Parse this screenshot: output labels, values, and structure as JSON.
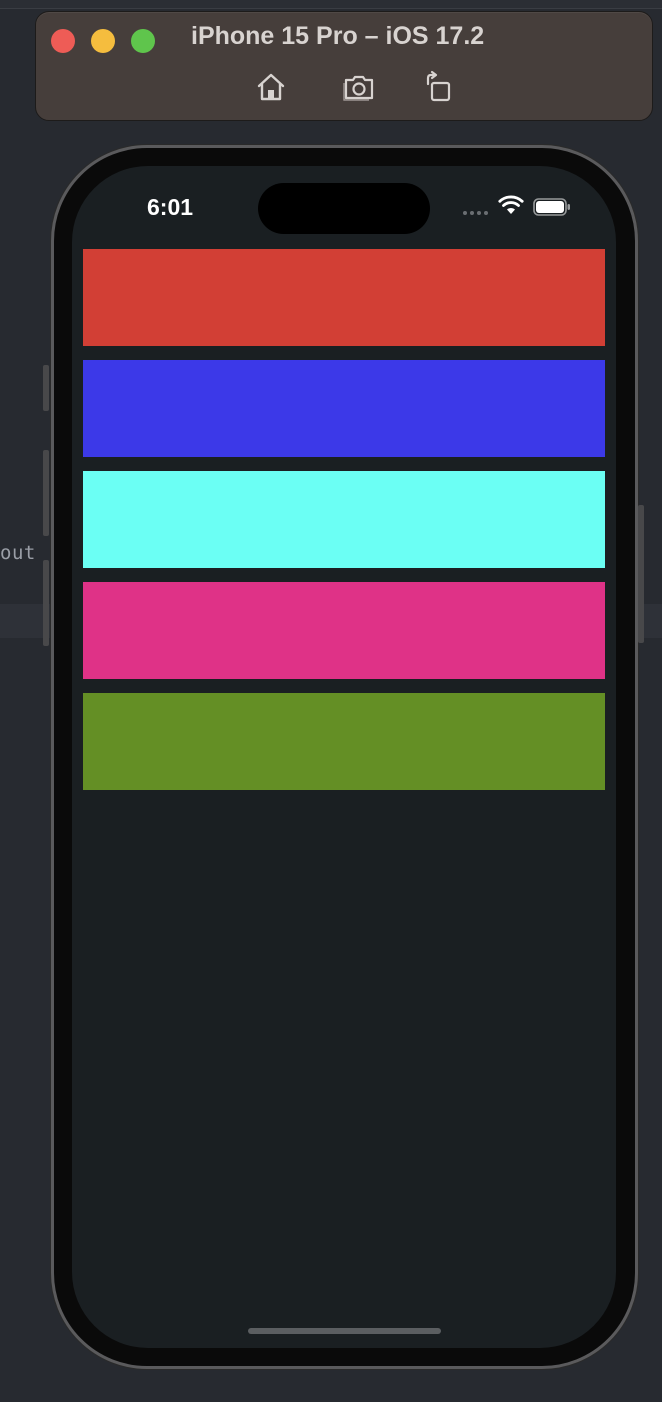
{
  "window": {
    "title": "iPhone 15 Pro – iOS 17.2",
    "toolbar": {
      "home_icon": "home-icon",
      "screenshot_icon": "camera-icon",
      "rotate_icon": "rotate-icon"
    }
  },
  "editor": {
    "partial_text": "out"
  },
  "device": {
    "status_bar": {
      "time": "6:01",
      "icons": [
        "signal-dots-icon",
        "wifi-icon",
        "battery-icon"
      ]
    },
    "bars": [
      {
        "color": "#d23f35"
      },
      {
        "color": "#3c39e8"
      },
      {
        "color": "#6bfff4"
      },
      {
        "color": "#df3287"
      },
      {
        "color": "#648f25"
      }
    ]
  },
  "colors": {
    "screen_background": "#1a1f22",
    "titlebar_background": "#463e3b"
  }
}
